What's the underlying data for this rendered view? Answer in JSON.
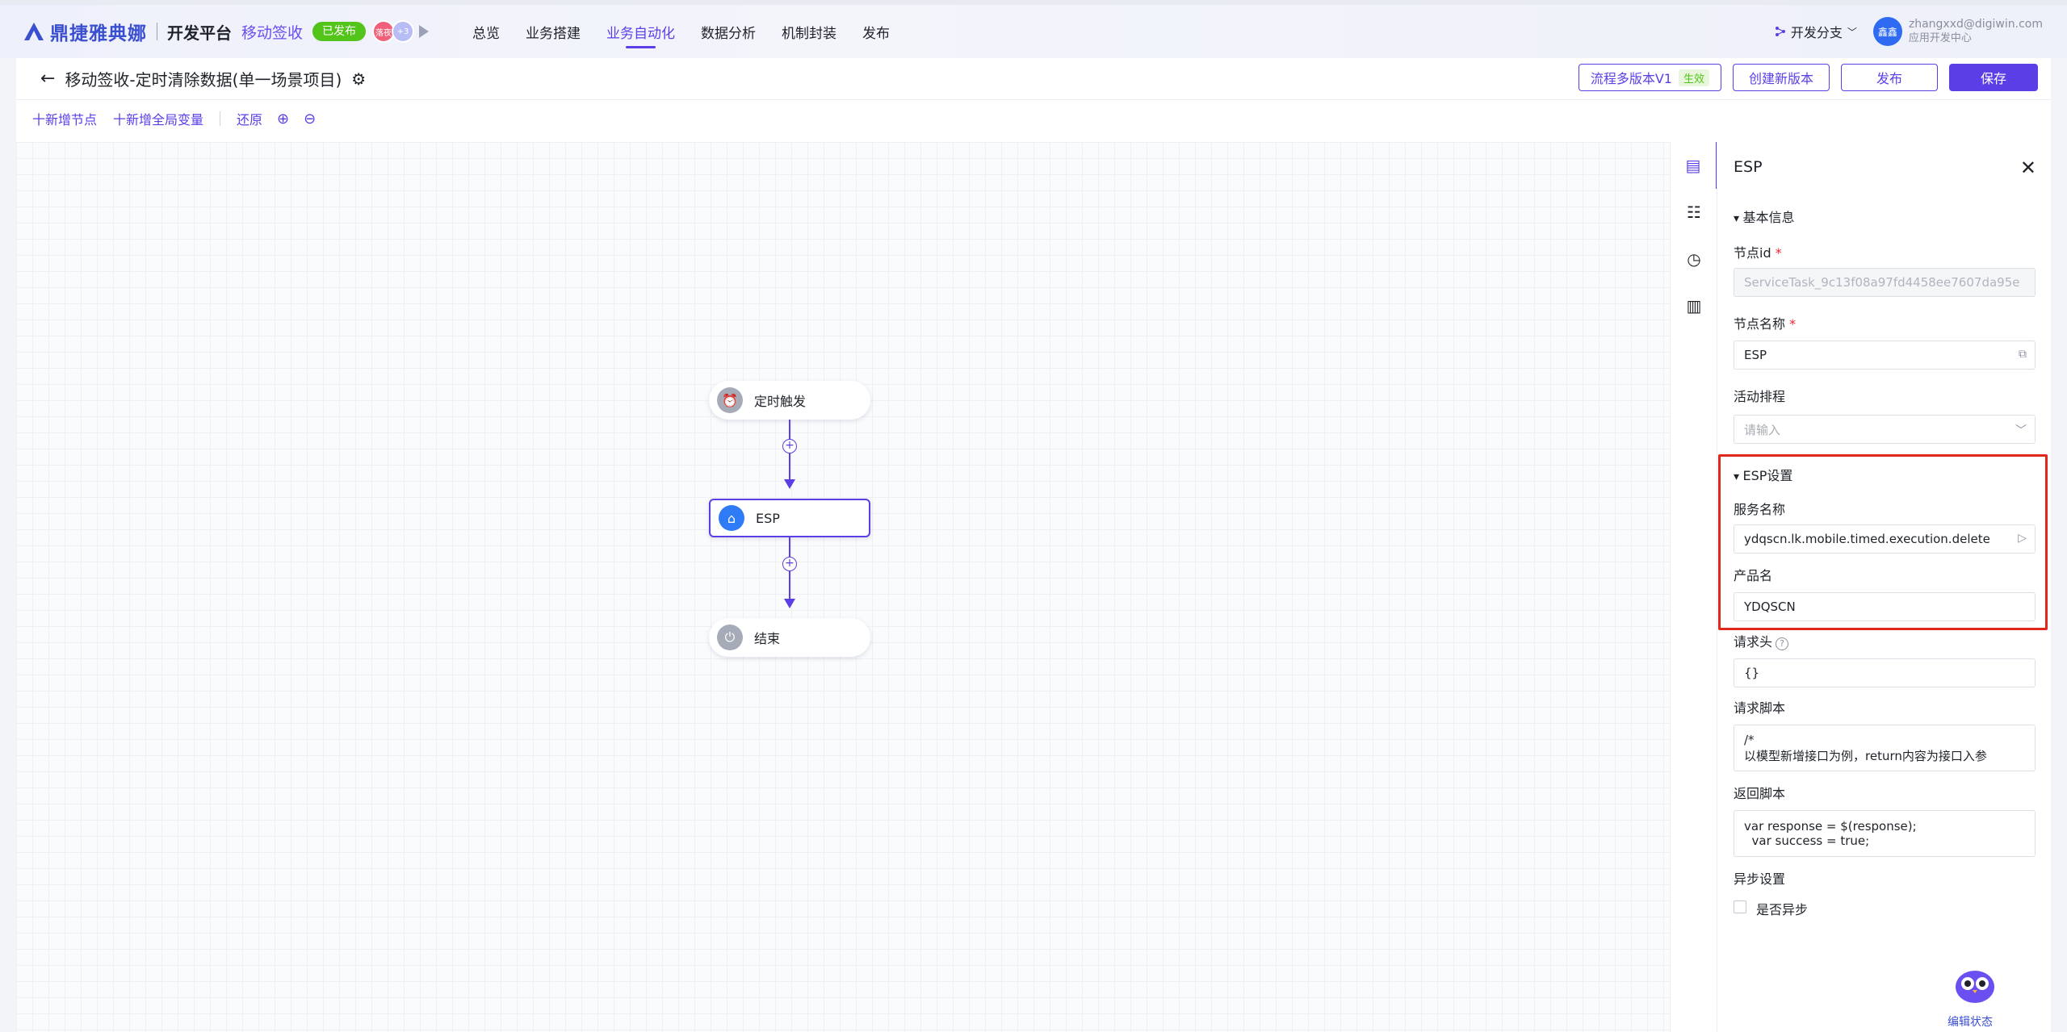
{
  "nav": {
    "brand": "鼎捷雅典娜",
    "platform": "开发平台",
    "app_name": "移动签收",
    "publish_status": "已发布",
    "collab_avatar_1": "落夜",
    "collab_avatar_2": "+3",
    "tabs": [
      "总览",
      "业务搭建",
      "业务自动化",
      "数据分析",
      "机制封装",
      "发布"
    ],
    "active_tab": "业务自动化",
    "branch": "开发分支",
    "user_avatar": "鑫鑫",
    "user_email": "zhangxxd@digiwin.com",
    "user_role": "应用开发中心"
  },
  "header": {
    "title": "移动签收-定时清除数据(单一场景项目)",
    "version_btn": "流程多版本V1",
    "version_status": "生效",
    "new_version_btn": "创建新版本",
    "publish_btn": "发布",
    "save_btn": "保存"
  },
  "toolbar": {
    "add_node": "十新增节点",
    "add_global_var": "十新增全局变量",
    "restore": "还原"
  },
  "flow": {
    "nodes": [
      {
        "label": "定时触发",
        "icon": "alarm-clock-icon"
      },
      {
        "label": "ESP",
        "icon": "esp-icon"
      },
      {
        "label": "结束",
        "icon": "power-icon"
      }
    ]
  },
  "panel": {
    "title": "ESP",
    "basic_section": "基本信息",
    "node_id_label": "节点id",
    "node_id_value": "ServiceTask_9c13f08a97fd4458ee7607da95e",
    "node_name_label": "节点名称",
    "node_name_value": "ESP",
    "activity_label": "活动排程",
    "activity_placeholder": "请输入",
    "esp_section": "ESP设置",
    "service_label": "服务名称",
    "service_value": "ydqscn.lk.mobile.timed.execution.delete",
    "product_label": "产品名",
    "product_value": "YDQSCN",
    "req_header_label": "请求头",
    "req_header_value": "{}",
    "req_script_label": "请求脚本",
    "req_script_line1": "/*",
    "req_script_line2": "以模型新增接口为例，return内容为接口入参",
    "resp_script_label": "返回脚本",
    "resp_script_line1": "var response = $(response);",
    "resp_script_line2": "  var success = true;",
    "async_label": "异步设置",
    "async_checkbox": "是否异步"
  },
  "footer": {
    "edit_state": "编辑状态"
  },
  "colors": {
    "accent": "#5b3ee6",
    "brand": "#3b4fd1",
    "published": "#52c41a",
    "highlight_box": "#e0271e"
  }
}
